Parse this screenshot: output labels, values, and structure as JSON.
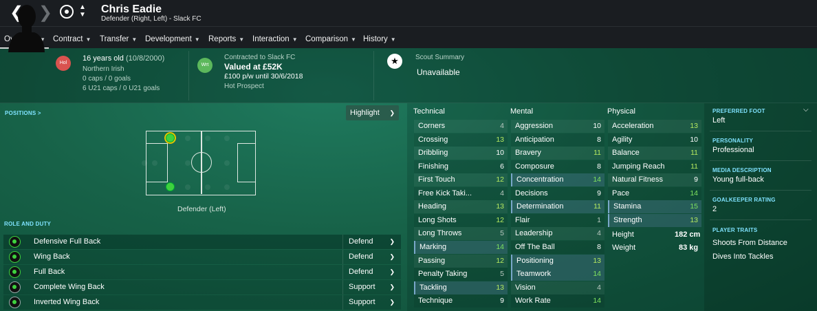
{
  "header": {
    "name": "Chris Eadie",
    "subtitle": "Defender (Right, Left) - Slack FC",
    "back_icon": "chevron-left-icon",
    "forward_icon": "chevron-right-icon"
  },
  "menu": [
    {
      "label": "Overview"
    },
    {
      "label": "Contract"
    },
    {
      "label": "Transfer"
    },
    {
      "label": "Development"
    },
    {
      "label": "Reports"
    },
    {
      "label": "Interaction"
    },
    {
      "label": "Comparison"
    },
    {
      "label": "History"
    }
  ],
  "info": {
    "nation_badge": "Hol",
    "age": "16 years old",
    "dob": "(10/8/2000)",
    "nationality": "Northern Irish",
    "caps": "0 caps / 0 goals",
    "u21": "6 U21 caps / 0 U21 goals",
    "contract_badge": "Wrt",
    "contracted": "Contracted to Slack FC",
    "value": "Valued at £52K",
    "wage": "£100 p/w until 30/6/2018",
    "prospect": "Hot Prospect",
    "scout_label": "Scout Summary",
    "scout_value": "Unavailable"
  },
  "positions": {
    "title": "POSITIONS >",
    "highlight": "Highlight",
    "label": "Defender (Left)"
  },
  "roles": {
    "title": "ROLE AND DUTY",
    "items": [
      {
        "name": "Defensive Full Back",
        "duty": "Defend"
      },
      {
        "name": "Wing Back",
        "duty": "Defend"
      },
      {
        "name": "Full Back",
        "duty": "Defend"
      },
      {
        "name": "Complete Wing Back",
        "duty": "Support"
      },
      {
        "name": "Inverted Wing Back",
        "duty": "Support"
      }
    ]
  },
  "attributes": {
    "technical_title": "Technical",
    "mental_title": "Mental",
    "physical_title": "Physical",
    "technical": [
      {
        "name": "Corners",
        "value": "4"
      },
      {
        "name": "Crossing",
        "value": "13"
      },
      {
        "name": "Dribbling",
        "value": "10"
      },
      {
        "name": "Finishing",
        "value": "6"
      },
      {
        "name": "First Touch",
        "value": "12"
      },
      {
        "name": "Free Kick Taki...",
        "value": "4"
      },
      {
        "name": "Heading",
        "value": "13"
      },
      {
        "name": "Long Shots",
        "value": "12"
      },
      {
        "name": "Long Throws",
        "value": "5"
      },
      {
        "name": "Marking",
        "value": "14"
      },
      {
        "name": "Passing",
        "value": "12"
      },
      {
        "name": "Penalty Taking",
        "value": "5"
      },
      {
        "name": "Tackling",
        "value": "13"
      },
      {
        "name": "Technique",
        "value": "9"
      }
    ],
    "mental": [
      {
        "name": "Aggression",
        "value": "10"
      },
      {
        "name": "Anticipation",
        "value": "8"
      },
      {
        "name": "Bravery",
        "value": "11"
      },
      {
        "name": "Composure",
        "value": "8"
      },
      {
        "name": "Concentration",
        "value": "14"
      },
      {
        "name": "Decisions",
        "value": "9"
      },
      {
        "name": "Determination",
        "value": "11"
      },
      {
        "name": "Flair",
        "value": "1"
      },
      {
        "name": "Leadership",
        "value": "4"
      },
      {
        "name": "Off The Ball",
        "value": "8"
      },
      {
        "name": "Positioning",
        "value": "13"
      },
      {
        "name": "Teamwork",
        "value": "14"
      },
      {
        "name": "Vision",
        "value": "4"
      },
      {
        "name": "Work Rate",
        "value": "14"
      }
    ],
    "physical": [
      {
        "name": "Acceleration",
        "value": "13"
      },
      {
        "name": "Agility",
        "value": "10"
      },
      {
        "name": "Balance",
        "value": "11"
      },
      {
        "name": "Jumping Reach",
        "value": "11"
      },
      {
        "name": "Natural Fitness",
        "value": "9"
      },
      {
        "name": "Pace",
        "value": "14"
      },
      {
        "name": "Stamina",
        "value": "15"
      },
      {
        "name": "Strength",
        "value": "13"
      }
    ],
    "height_label": "Height",
    "height": "182 cm",
    "weight_label": "Weight",
    "weight": "83 kg"
  },
  "side": {
    "preferred_foot_title": "PREFERRED FOOT",
    "preferred_foot": "Left",
    "personality_title": "PERSONALITY",
    "personality": "Professional",
    "media_title": "MEDIA DESCRIPTION",
    "media": "Young full-back",
    "gk_title": "GOALKEEPER RATING",
    "gk": "2",
    "traits_title": "PLAYER TRAITS",
    "traits": [
      "Shoots From Distance",
      "Dives Into Tackles"
    ]
  }
}
